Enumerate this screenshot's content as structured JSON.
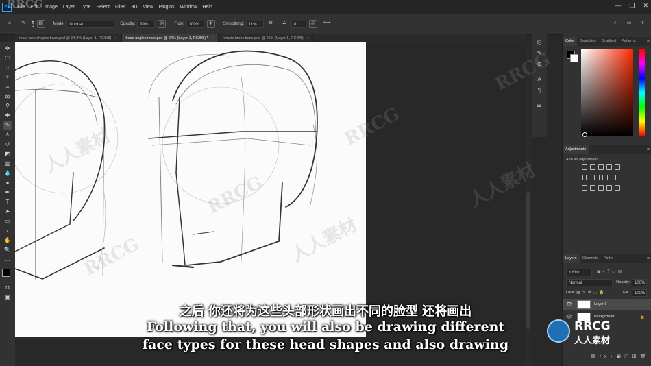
{
  "watermark": {
    "top_left": "RRCG"
  },
  "menu": {
    "items": [
      "File",
      "Edit",
      "Image",
      "Layer",
      "Type",
      "Select",
      "Filter",
      "3D",
      "View",
      "Plugins",
      "Window",
      "Help"
    ]
  },
  "options": {
    "brush_size": "5",
    "mode_label": "Mode:",
    "mode_value": "Normal",
    "opacity_label": "Opacity:",
    "opacity_value": "99%",
    "flow_label": "Flow:",
    "flow_value": "100%",
    "smoothing_label": "Smoothing:",
    "smoothing_value": "11%",
    "angle_value": "0°"
  },
  "tabs": [
    {
      "label": "male face shapes base.psd @ 24.2% (Layer 1, RGB/8)",
      "close": "×"
    },
    {
      "label": "head angles male.psd @ 64% (Layer 1, RGB/8) *",
      "close": "×"
    },
    {
      "label": "female faces base.psd @ 25% (Layer 1, RGB/8)",
      "close": "×"
    }
  ],
  "color_panel": {
    "tabs": [
      "Color",
      "Swatches",
      "Gradient",
      "Patterns"
    ]
  },
  "adjustments_panel": {
    "title": "Adjustments",
    "subtitle": "Add an adjustment"
  },
  "layers_panel": {
    "tabs": [
      "Layers",
      "Channels",
      "Paths"
    ],
    "kind": "Kind",
    "blend_mode": "Normal",
    "opacity_label": "Opacity:",
    "opacity_value": "100%",
    "lock_label": "Lock:",
    "fill_label": "Fill:",
    "fill_value": "100%",
    "layers": [
      {
        "name": "Layer 1",
        "selected": true
      },
      {
        "name": "Background",
        "selected": false
      }
    ]
  },
  "subtitles": {
    "zh": "之后 你还将为这些头部形状画出不同的脸型 还将画出",
    "en_line1": "Following that, you will also be drawing different",
    "en_line2": "face types for these head shapes and also drawing"
  },
  "logo": {
    "line1": "RRCG",
    "line2": "人人素材"
  },
  "colors": {
    "accent": "#31a8ff",
    "panel_bg": "#323232",
    "workspace_bg": "#282828"
  }
}
